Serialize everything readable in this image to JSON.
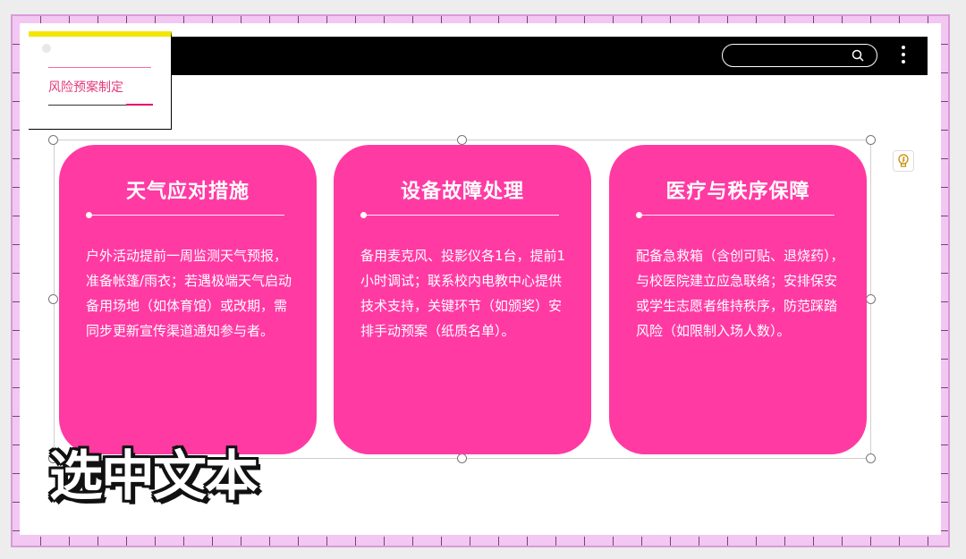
{
  "label_box": {
    "text": "风险预案制定"
  },
  "search": {
    "placeholder": ""
  },
  "cards": [
    {
      "title": "天气应对措施",
      "body": "户外活动提前一周监测天气预报，准备帐篷/雨衣；若遇极端天气启动备用场地（如体育馆）或改期，需同步更新宣传渠道通知参与者。"
    },
    {
      "title": "设备故障处理",
      "body": "备用麦克风、投影仪各1台，提前1小时调试；联系校内电教中心提供技术支持，关键环节（如颁奖）安排手动预案（纸质名单）。"
    },
    {
      "title": "医疗与秩序保障",
      "body": "配备急救箱（含创可贴、退烧药），与校医院建立应急联络；安排保安或学生志愿者维持秩序，防范踩踏风险（如限制入场人数）。"
    }
  ],
  "overlay": {
    "caption": "选中文本"
  },
  "colors": {
    "card_pink": "#ff3aa3",
    "label_accent": "#e23a7a",
    "topbar": "#000000",
    "frame": "#f2c7f2",
    "yellow_bar": "#f3e600"
  },
  "icons": {
    "search": "search-icon",
    "more": "more-vertical-icon",
    "bulb": "lightbulb-icon"
  }
}
